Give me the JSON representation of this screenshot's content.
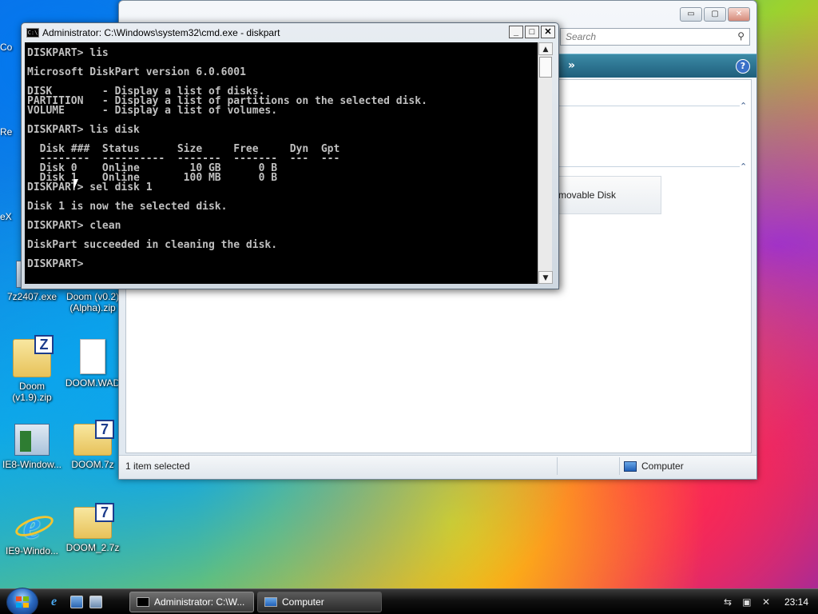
{
  "desktop": {
    "icons": [
      {
        "label": "7z2407.exe"
      },
      {
        "label": "Doom (v0.2)\n(Alpha).zip"
      },
      {
        "label": "Doom\n(v1.9).zip",
        "badge": "Z"
      },
      {
        "label": "DOOM.WAD"
      },
      {
        "label": "IE8-Window..."
      },
      {
        "label": "DOOM.7z",
        "badge": "7"
      },
      {
        "label": "IE9-Windo...",
        "glyph": "e"
      },
      {
        "label": "DOOM_2.7z",
        "badge": "7"
      }
    ],
    "partial_labels": [
      "Co",
      "Re",
      "eX"
    ]
  },
  "explorer": {
    "search_placeholder": "Search",
    "cmdbar_chevron": "»",
    "help_glyph": "?",
    "tile_label": "movable Disk",
    "status_selected": "1 item selected",
    "status_location": "Computer",
    "caption": {
      "minimize": "▭",
      "maximize": "▢",
      "close": "✕"
    }
  },
  "cmd": {
    "title": "Administrator: C:\\Windows\\system32\\cmd.exe - diskpart",
    "icon_text": "C:\\",
    "buttons": {
      "minimize": "_",
      "maximize": "□",
      "close": "✕"
    },
    "lines": [
      "DISKPART> lis",
      "",
      "Microsoft DiskPart version 6.0.6001",
      "",
      "DISK        - Display a list of disks.",
      "PARTITION   - Display a list of partitions on the selected disk.",
      "VOLUME      - Display a list of volumes.",
      "",
      "DISKPART> lis disk",
      "",
      "  Disk ###  Status      Size     Free     Dyn  Gpt",
      "  --------  ----------  -------  -------  ---  ---",
      "  Disk 0    Online        10 GB      0 B",
      "  Disk 1    Online       100 MB      0 B",
      "DISKPART> sel disk 1",
      "",
      "Disk 1 is now the selected disk.",
      "",
      "DISKPART> clean",
      "",
      "DiskPart succeeded in cleaning the disk.",
      "",
      "DISKPART>"
    ],
    "scroll": {
      "up": "▲",
      "down": "▼"
    }
  },
  "taskbar": {
    "tasks": [
      {
        "label": "Administrator: C:\\W..."
      },
      {
        "label": "Computer"
      }
    ],
    "clock": "23:14"
  },
  "colors": {
    "console_bg": "#000000",
    "console_fg": "#c0c0c0",
    "cmdbar": "#2a6f8c"
  }
}
